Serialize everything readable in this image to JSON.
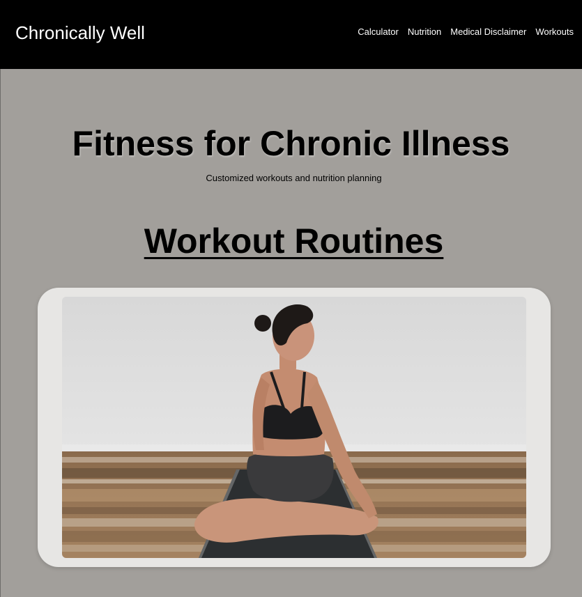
{
  "header": {
    "brand": "Chronically Well",
    "nav": [
      {
        "label": "Calculator"
      },
      {
        "label": "Nutrition"
      },
      {
        "label": "Medical Disclaimer"
      },
      {
        "label": "Workouts"
      }
    ]
  },
  "hero": {
    "title": "Fitness for Chronic Illness",
    "subtitle": "Customized workouts and nutrition planning"
  },
  "workouts": {
    "title": "Workout Routines",
    "image_subject": "woman-seated-yoga-twist-photo"
  },
  "colors": {
    "header_bg": "#000000",
    "page_bg": "#a29f9b",
    "card_bg": "#e7e6e4"
  }
}
